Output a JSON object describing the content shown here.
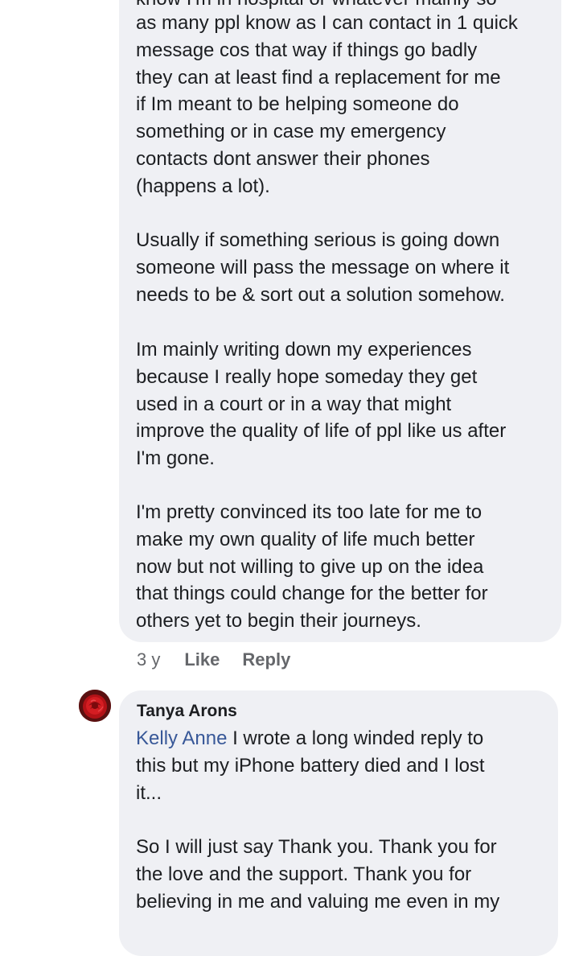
{
  "comment1": {
    "clipped_top_line": "know I'm in hospital or whatever mainly so",
    "paragraphs": [
      "as many ppl know as I can contact in 1 quick\nmessage cos that way if things go badly\nthey can at least find a replacement for me\nif Im meant to be helping someone do\nsomething or in case my emergency\ncontacts dont answer their phones\n(happens a lot).",
      "Usually if something serious is going down\nsomeone will pass the message on where it\nneeds to be & sort out a solution somehow.",
      "Im mainly writing down my experiences\nbecause I really hope someday they get\nused in a court or in a way that might\nimprove the quality of life of ppl like us after\nI'm gone.",
      "I'm pretty convinced its too late for me to\nmake my own quality of life much better\nnow but not willing to give up on the idea\nthat things could change for the better for\nothers yet to begin their journeys."
    ],
    "actions": {
      "time": "3 y",
      "like_label": "Like",
      "reply_label": "Reply"
    }
  },
  "comment2": {
    "author": "Tanya Arons",
    "mention": "Kelly Anne",
    "para1_rest": " I wrote a long winded reply to\nthis but my iPhone battery died and I lost\nit...",
    "para2": "So I will just say Thank you.  Thank you for\nthe love and the support.  Thank you for\nbelieving in me and valuing me even in my",
    "avatar_icon": "red-rose-avatar"
  },
  "colors": {
    "bubble_bg": "#eff0f4",
    "text": "#1c1e21",
    "meta_text": "#65676b",
    "mention_link": "#385898"
  }
}
